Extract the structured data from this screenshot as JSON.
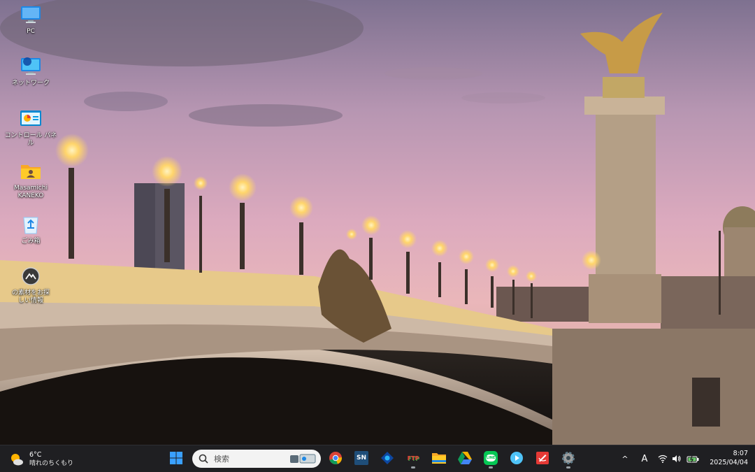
{
  "desktop": {
    "icons": [
      {
        "label": "PC",
        "icon": "monitor-icon"
      },
      {
        "label": "ネットワーク",
        "icon": "network-icon"
      },
      {
        "label": "コントロール パネル",
        "icon": "control-panel-icon"
      },
      {
        "label": "Masamichi\nKANEKO",
        "icon": "user-folder-icon"
      },
      {
        "label": "ごみ箱",
        "icon": "recycle-bin-icon"
      },
      {
        "label": "の素材をお探\nしい情報",
        "icon": "bing-spotlight-icon"
      }
    ]
  },
  "taskbar": {
    "weather": {
      "temperature": "6°C",
      "condition": "晴れのちくもり",
      "icon": "sun-cloud-icon"
    },
    "search": {
      "placeholder": "検索"
    },
    "apps": [
      {
        "name": "start",
        "icon": "windows-start-icon"
      },
      {
        "name": "chrome",
        "icon": "chrome-icon"
      },
      {
        "name": "sn-app",
        "icon": "sn-icon",
        "text": "SN"
      },
      {
        "name": "browser-app",
        "icon": "blue-diamond-icon"
      },
      {
        "name": "ftp-app",
        "icon": "ftp-icon",
        "text": "FTP"
      },
      {
        "name": "file-explorer",
        "icon": "folder-icon"
      },
      {
        "name": "google-drive",
        "icon": "drive-icon"
      },
      {
        "name": "line",
        "icon": "line-icon",
        "text": "LINE"
      },
      {
        "name": "player-app",
        "icon": "play-icon"
      },
      {
        "name": "red-app",
        "icon": "red-note-icon"
      },
      {
        "name": "settings",
        "icon": "gear-icon"
      }
    ],
    "tray": {
      "chevron": "^",
      "ime": "A",
      "icons": [
        "chevron-up-icon",
        "ime-icon",
        "wifi-icon",
        "volume-icon",
        "battery-icon"
      ]
    },
    "clock": {
      "time": "8:07",
      "date": "2025/04/04"
    }
  },
  "colors": {
    "taskbar": "#1f1f22",
    "accent": "#0078d4"
  }
}
